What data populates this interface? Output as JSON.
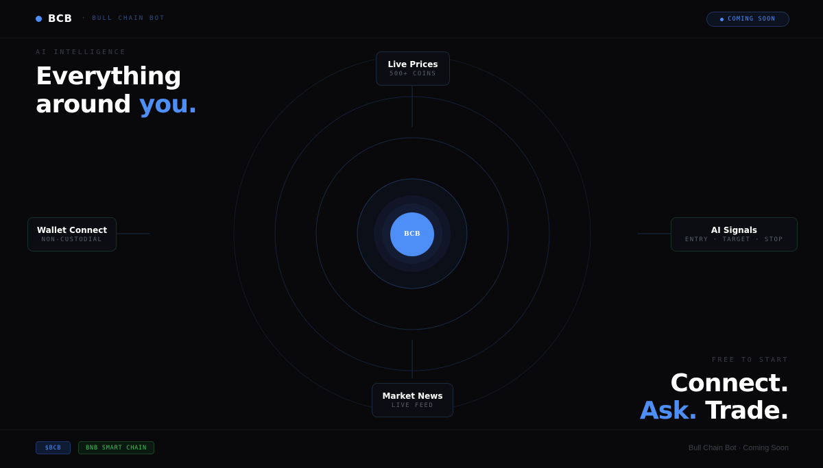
{
  "header": {
    "brand": "BCB",
    "subtitle": "· BULL CHAIN BOT",
    "status_pill": "COMING SOON"
  },
  "hero": {
    "eyebrow": "AI INTELLIGENCE",
    "line1": "Everything",
    "line2_prefix": "around ",
    "line2_accent": "you."
  },
  "orbit": {
    "center_label": "BCB",
    "nodes": {
      "live_prices": {
        "title": "Live Prices",
        "subtitle": "500+ COINS"
      },
      "wallet_connect": {
        "title": "Wallet Connect",
        "subtitle": "NON-CUSTODIAL"
      },
      "ai_signals": {
        "title": "AI Signals",
        "subtitle": "ENTRY · TARGET · STOP"
      },
      "market_news": {
        "title": "Market News",
        "subtitle": "LIVE FEED"
      }
    }
  },
  "cta": {
    "eyebrow": "FREE TO START",
    "line1": "Connect.",
    "line2_accent": "Ask.",
    "line2_rest": " Trade."
  },
  "footer": {
    "ticker_tag": "$BCB",
    "chain_tag": "BNB SMART CHAIN",
    "note": "Bull Chain Bot · Coming Soon"
  },
  "colors": {
    "background": "#09090b",
    "accent": "#4d8ef7",
    "chain_green": "#3ec15a"
  }
}
